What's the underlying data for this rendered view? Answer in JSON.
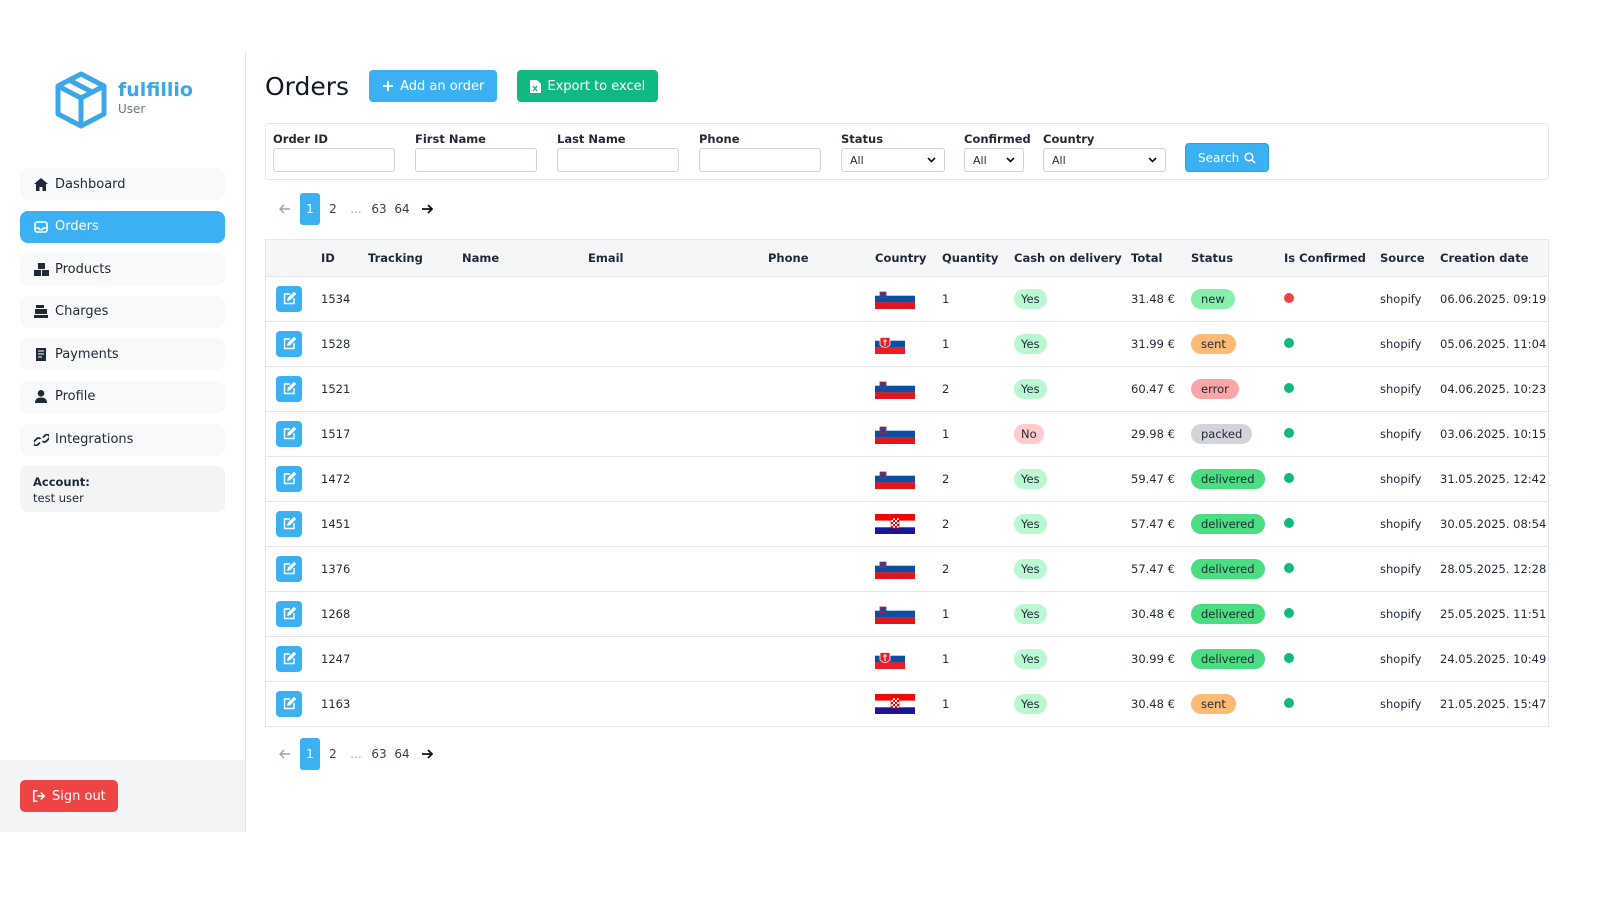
{
  "brand": {
    "name": "fulfillio",
    "role": "User",
    "color": "#3ba7e6"
  },
  "nav": [
    {
      "label": "Dashboard",
      "icon": "home-icon",
      "active": false
    },
    {
      "label": "Orders",
      "icon": "inbox-icon",
      "active": true
    },
    {
      "label": "Products",
      "icon": "boxes-icon",
      "active": false
    },
    {
      "label": "Charges",
      "icon": "cash-register-icon",
      "active": false
    },
    {
      "label": "Payments",
      "icon": "receipt-icon",
      "active": false
    },
    {
      "label": "Profile",
      "icon": "user-icon",
      "active": false
    },
    {
      "label": "Integrations",
      "icon": "link-icon",
      "active": false
    }
  ],
  "account": {
    "label": "Account:",
    "name": "test user"
  },
  "signout_label": "Sign out",
  "page": {
    "title": "Orders",
    "add_label": "Add an order",
    "export_label": "Export to excel"
  },
  "filters": {
    "order_id": "Order ID",
    "first_name": "First Name",
    "last_name": "Last Name",
    "phone": "Phone",
    "status": "Status",
    "status_value": "All",
    "confirmed": "Confirmed",
    "confirmed_value": "All",
    "country": "Country",
    "country_value": "All",
    "search_label": "Search"
  },
  "pagination": {
    "pages": [
      "1",
      "2",
      "...",
      "63",
      "64"
    ],
    "current": "1"
  },
  "columns": [
    "",
    "ID",
    "Tracking",
    "Name",
    "Email",
    "Phone",
    "Country",
    "Quantity",
    "Cash on delivery",
    "Total",
    "Status",
    "Is Confirmed",
    "Source",
    "Creation date"
  ],
  "status_colors": {
    "new": "#86efac",
    "sent": "#fdba74",
    "error": "#fca5a5",
    "packed": "#d1d5db",
    "delivered": "#4ade80"
  },
  "orders": [
    {
      "id": "1534",
      "country": "SI",
      "qty": "1",
      "cod": "Yes",
      "total": "31.48 €",
      "status": "new",
      "confirmed": false,
      "source": "shopify",
      "date": "06.06.2025. 09:19"
    },
    {
      "id": "1528",
      "country": "SK",
      "qty": "1",
      "cod": "Yes",
      "total": "31.99 €",
      "status": "sent",
      "confirmed": true,
      "source": "shopify",
      "date": "05.06.2025. 11:04"
    },
    {
      "id": "1521",
      "country": "SI",
      "qty": "2",
      "cod": "Yes",
      "total": "60.47 €",
      "status": "error",
      "confirmed": true,
      "source": "shopify",
      "date": "04.06.2025. 10:23"
    },
    {
      "id": "1517",
      "country": "SI",
      "qty": "1",
      "cod": "No",
      "total": "29.98 €",
      "status": "packed",
      "confirmed": true,
      "source": "shopify",
      "date": "03.06.2025. 10:15"
    },
    {
      "id": "1472",
      "country": "SI",
      "qty": "2",
      "cod": "Yes",
      "total": "59.47 €",
      "status": "delivered",
      "confirmed": true,
      "source": "shopify",
      "date": "31.05.2025. 12:42"
    },
    {
      "id": "1451",
      "country": "HR",
      "qty": "2",
      "cod": "Yes",
      "total": "57.47 €",
      "status": "delivered",
      "confirmed": true,
      "source": "shopify",
      "date": "30.05.2025. 08:54"
    },
    {
      "id": "1376",
      "country": "SI",
      "qty": "2",
      "cod": "Yes",
      "total": "57.47 €",
      "status": "delivered",
      "confirmed": true,
      "source": "shopify",
      "date": "28.05.2025. 12:28"
    },
    {
      "id": "1268",
      "country": "SI",
      "qty": "1",
      "cod": "Yes",
      "total": "30.48 €",
      "status": "delivered",
      "confirmed": true,
      "source": "shopify",
      "date": "25.05.2025. 11:51"
    },
    {
      "id": "1247",
      "country": "SK",
      "qty": "1",
      "cod": "Yes",
      "total": "30.99 €",
      "status": "delivered",
      "confirmed": true,
      "source": "shopify",
      "date": "24.05.2025. 10:49"
    },
    {
      "id": "1163",
      "country": "HR",
      "qty": "1",
      "cod": "Yes",
      "total": "30.48 €",
      "status": "sent",
      "confirmed": true,
      "source": "shopify",
      "date": "21.05.2025. 15:47"
    }
  ]
}
